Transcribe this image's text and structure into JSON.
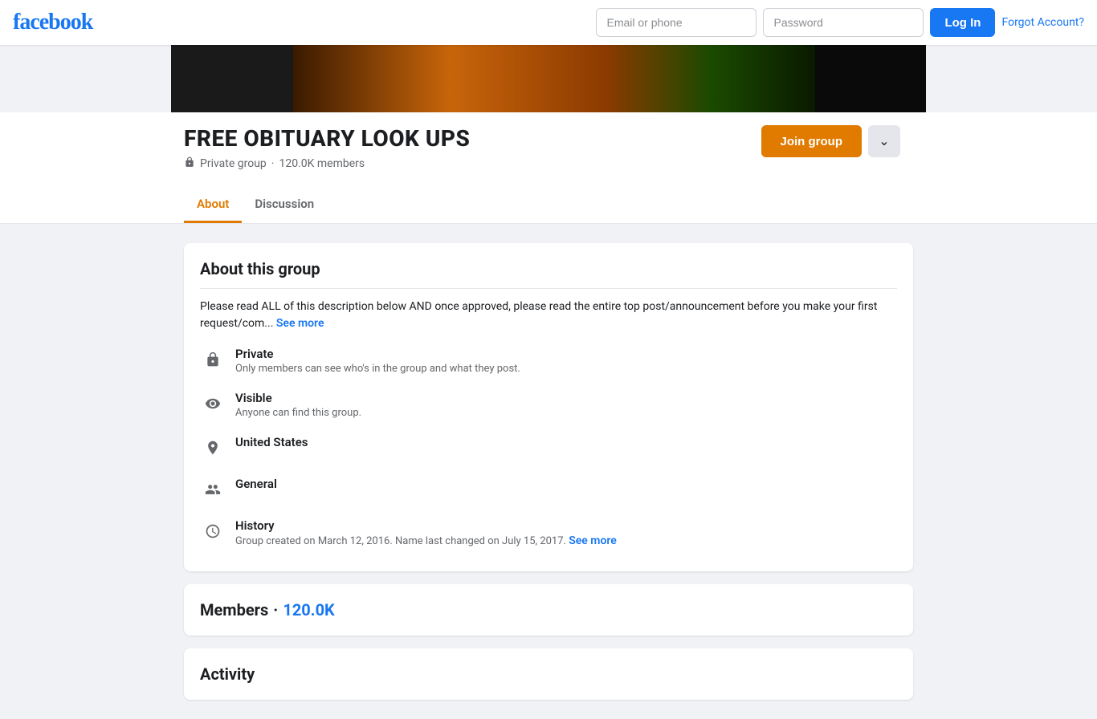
{
  "header": {
    "logo": "facebook",
    "email_placeholder": "Email or phone",
    "password_placeholder": "Password",
    "login_label": "Log In",
    "forgot_label": "Forgot Account?"
  },
  "group": {
    "title": "FREE OBITUARY LOOK UPS",
    "meta_privacy": "Private group",
    "meta_members": "120.0K members",
    "join_label": "Join group"
  },
  "tabs": [
    {
      "id": "about",
      "label": "About",
      "active": true
    },
    {
      "id": "discussion",
      "label": "Discussion",
      "active": false
    }
  ],
  "about_card": {
    "title": "About this group",
    "description": "Please read ALL of this description below AND once approved, please read the entire top post/announcement before you make your first request/com...",
    "see_more_label": "See more",
    "privacy": {
      "title": "Private",
      "subtitle": "Only members can see who's in the group and what they post."
    },
    "visibility": {
      "title": "Visible",
      "subtitle": "Anyone can find this group."
    },
    "location": {
      "title": "United States"
    },
    "category": {
      "title": "General"
    },
    "history": {
      "title": "History",
      "subtitle": "Group created on March 12, 2016. Name last changed on July 15, 2017.",
      "see_more_label": "See more"
    }
  },
  "members_card": {
    "label": "Members",
    "separator": "·",
    "count": "120.0K"
  },
  "activity_card": {
    "label": "Activity"
  }
}
